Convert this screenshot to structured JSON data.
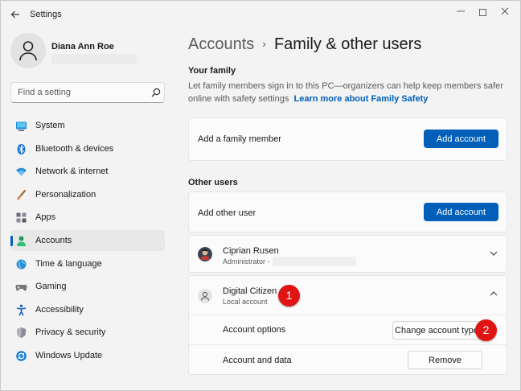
{
  "app": {
    "title": "Settings"
  },
  "profile": {
    "name": "Diana Ann Roe"
  },
  "search": {
    "placeholder": "Find a setting"
  },
  "sidebar": {
    "items": [
      {
        "label": "System",
        "icon": "system-icon"
      },
      {
        "label": "Bluetooth & devices",
        "icon": "bluetooth-icon"
      },
      {
        "label": "Network & internet",
        "icon": "wifi-icon"
      },
      {
        "label": "Personalization",
        "icon": "brush-icon"
      },
      {
        "label": "Apps",
        "icon": "apps-icon"
      },
      {
        "label": "Accounts",
        "icon": "accounts-icon",
        "active": true
      },
      {
        "label": "Time & language",
        "icon": "globe-icon"
      },
      {
        "label": "Gaming",
        "icon": "gamepad-icon"
      },
      {
        "label": "Accessibility",
        "icon": "accessibility-icon"
      },
      {
        "label": "Privacy & security",
        "icon": "shield-icon"
      },
      {
        "label": "Windows Update",
        "icon": "update-icon"
      }
    ]
  },
  "breadcrumb": {
    "parent": "Accounts",
    "separator": "›",
    "current": "Family & other users"
  },
  "your_family": {
    "title": "Your family",
    "description": "Let family members sign in to this PC—organizers can help keep members safer online with safety settings",
    "link": "Learn more about Family Safety",
    "add_label": "Add a family member",
    "add_button": "Add account"
  },
  "other_users": {
    "title": "Other users",
    "add_label": "Add other user",
    "add_button": "Add account",
    "users": [
      {
        "name": "Ciprian Rusen",
        "role": "Administrator -"
      },
      {
        "name": "Digital Citizen",
        "role": "Local account",
        "account_options_label": "Account options",
        "change_type_button": "Change account type",
        "account_data_label": "Account and data",
        "remove_button": "Remove"
      }
    ]
  },
  "annotations": {
    "badge1": "1",
    "badge2": "2"
  },
  "colors": {
    "accent": "#005fb8",
    "badge": "#e11414"
  }
}
